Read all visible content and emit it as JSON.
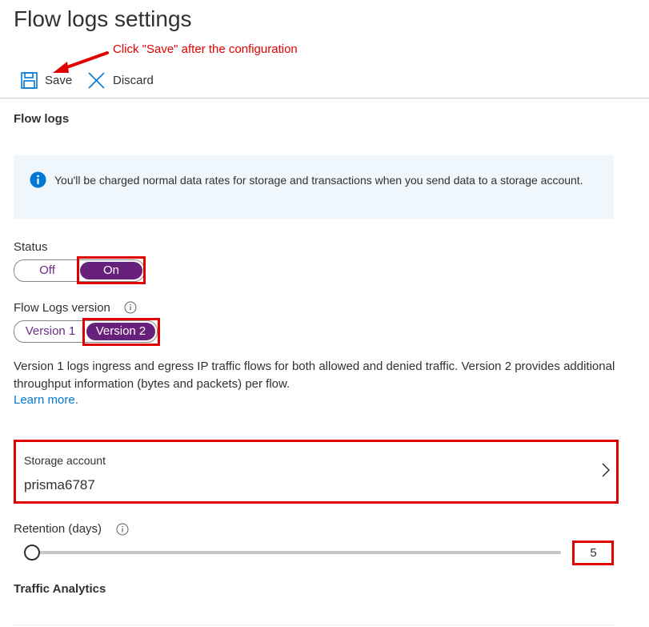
{
  "page": {
    "title": "Flow logs settings"
  },
  "annotation": {
    "text": "Click \"Save\" after the configuration",
    "color": "#e00000"
  },
  "toolbar": {
    "save_label": "Save",
    "save_icon": "save-icon",
    "discard_label": "Discard",
    "discard_icon": "close-icon"
  },
  "flow_logs": {
    "section_title": "Flow logs",
    "info_icon": "info-icon",
    "info_text": "You'll be charged normal data rates for storage and transactions when you send data to a storage account.",
    "status": {
      "label": "Status",
      "options": [
        "Off",
        "On"
      ],
      "selected": "On"
    },
    "version": {
      "label": "Flow Logs version",
      "help_icon": "info-circle-icon",
      "options": [
        "Version 1",
        "Version 2"
      ],
      "selected": "Version 2"
    },
    "description": "Version 1 logs ingress and egress IP traffic flows for both allowed and denied traffic. Version 2 provides additional throughput information (bytes and packets) per flow.",
    "learn_more": "Learn more.",
    "storage_account": {
      "label": "Storage account",
      "value": "prisma6787",
      "chevron_icon": "chevron-right-icon"
    },
    "retention": {
      "label": "Retention (days)",
      "help_icon": "info-circle-icon",
      "value": "5",
      "slider_fraction": 0.0
    }
  },
  "traffic_analytics": {
    "section_title": "Traffic Analytics"
  },
  "colors": {
    "accent_purple": "#68217a",
    "link_blue": "#0078d4",
    "highlight_red": "#e00000",
    "info_bg": "#eff6fc"
  }
}
